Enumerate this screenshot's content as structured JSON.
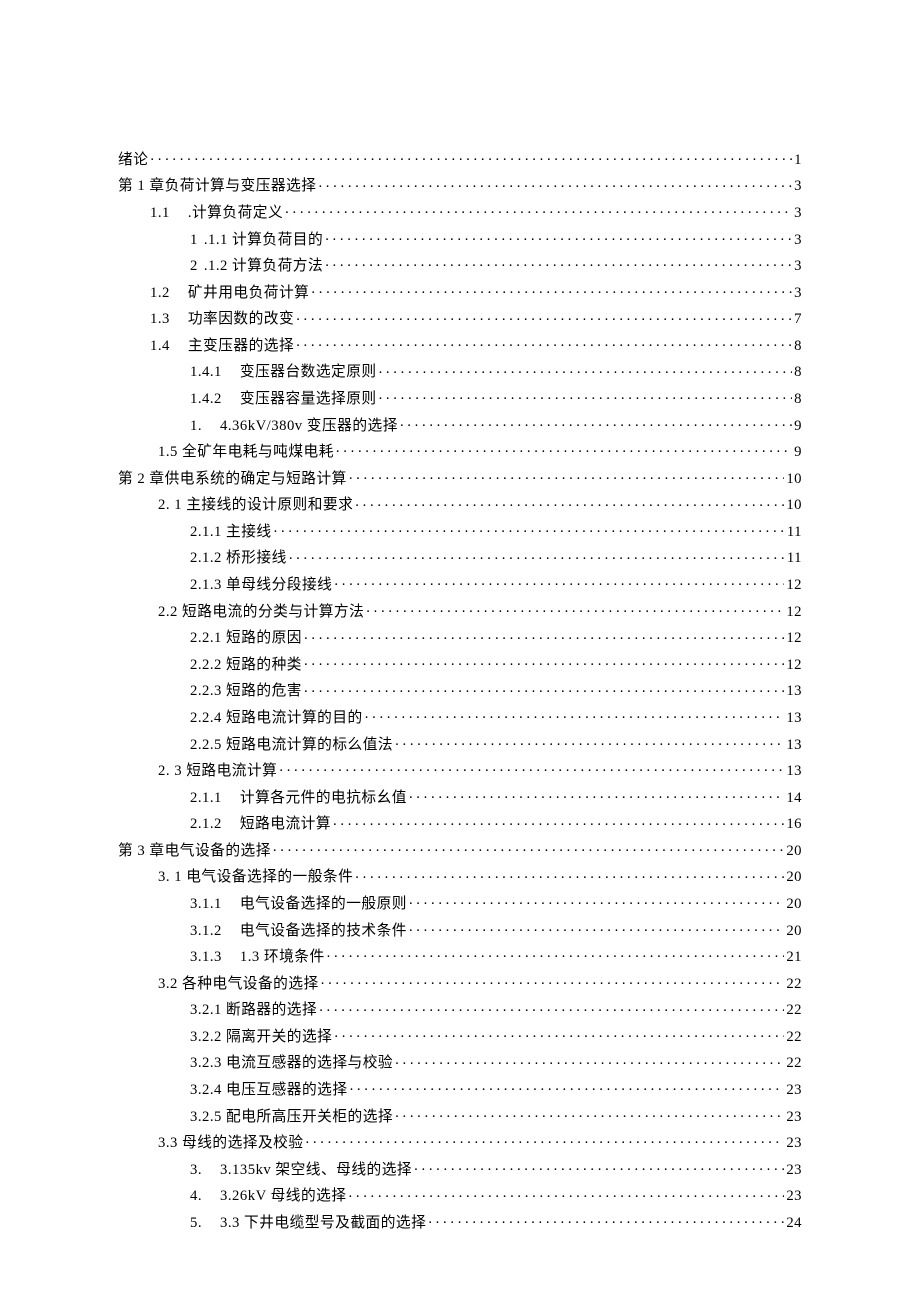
{
  "toc": [
    {
      "indent": "lv0",
      "num": "",
      "label": "绪论",
      "page": "1"
    },
    {
      "indent": "lv0",
      "num": "",
      "label": "第 1 章负荷计算与变压器选择",
      "page": "3"
    },
    {
      "indent": "lv1",
      "num": "1.1",
      "label": ".计算负荷定义",
      "page": "3"
    },
    {
      "indent": "lv2",
      "num": "1",
      "label": ".1.1 计算负荷目的",
      "page": "3"
    },
    {
      "indent": "lv2",
      "num": "2",
      "label": ".1.2 计算负荷方法",
      "page": "3"
    },
    {
      "indent": "lv1",
      "num": "1.2",
      "label": "矿井用电负荷计算",
      "page": "3"
    },
    {
      "indent": "lv1",
      "num": "1.3",
      "label": "功率因数的改变",
      "page": "7"
    },
    {
      "indent": "lv1",
      "num": "1.4",
      "label": "主变压器的选择",
      "page": "8"
    },
    {
      "indent": "lv2",
      "num": "1.4.1",
      "label": "变压器台数选定原则",
      "page": "8"
    },
    {
      "indent": "lv2",
      "num": "1.4.2",
      "label": "变压器容量选择原则",
      "page": "8"
    },
    {
      "indent": "lv2",
      "num": "1.",
      "label": "4.36kV/380v 变压器的选择",
      "page": "9"
    },
    {
      "indent": "lv1b",
      "num": "",
      "label": "1.5 全矿年电耗与吨煤电耗",
      "page": "9"
    },
    {
      "indent": "lv0",
      "num": "",
      "label": "第 2 章供电系统的确定与短路计算",
      "page": "10"
    },
    {
      "indent": "lv1b",
      "num": "",
      "label": "2.  1 主接线的设计原则和要求",
      "page": "10"
    },
    {
      "indent": "lv2b",
      "num": "",
      "label": "2.1.1 主接线",
      "page": "11"
    },
    {
      "indent": "lv2b",
      "num": "",
      "label": "2.1.2 桥形接线",
      "page": "11"
    },
    {
      "indent": "lv2b",
      "num": "",
      "label": "2.1.3 单母线分段接线",
      "page": "12"
    },
    {
      "indent": "lv1b",
      "num": "",
      "label": "2.2 短路电流的分类与计算方法",
      "page": "12"
    },
    {
      "indent": "lv2b",
      "num": "",
      "label": "2.2.1 短路的原因",
      "page": "12"
    },
    {
      "indent": "lv2b",
      "num": "",
      "label": "2.2.2 短路的种类",
      "page": "12"
    },
    {
      "indent": "lv2b",
      "num": "",
      "label": "2.2.3 短路的危害",
      "page": "13"
    },
    {
      "indent": "lv2b",
      "num": "",
      "label": "2.2.4 短路电流计算的目的",
      "page": "13"
    },
    {
      "indent": "lv2b",
      "num": "",
      "label": "2.2.5 短路电流计算的标么值法",
      "page": "13"
    },
    {
      "indent": "lv1b",
      "num": "",
      "label": "2.  3 短路电流计算",
      "page": "13"
    },
    {
      "indent": "lv2",
      "num": "2.1.1",
      "label": "计算各元件的电抗标幺值",
      "page": "14"
    },
    {
      "indent": "lv2",
      "num": "2.1.2",
      "label": "短路电流计算",
      "page": "16"
    },
    {
      "indent": "lv0",
      "num": "",
      "label": "第 3 章电气设备的选择",
      "page": "20"
    },
    {
      "indent": "lv1b",
      "num": "",
      "label": "3.  1 电气设备选择的一般条件",
      "page": "20"
    },
    {
      "indent": "lv2",
      "num": "3.1.1",
      "label": "电气设备选择的一般原则",
      "page": "20"
    },
    {
      "indent": "lv2",
      "num": "3.1.2",
      "label": "电气设备选择的技术条件",
      "page": "20"
    },
    {
      "indent": "lv2",
      "num": "3.1.3",
      "label": "1.3 环境条件",
      "page": "21"
    },
    {
      "indent": "lv1b",
      "num": "",
      "label": "3.2 各种电气设备的选择",
      "page": "22"
    },
    {
      "indent": "lv2b",
      "num": "",
      "label": "3.2.1 断路器的选择",
      "page": "22"
    },
    {
      "indent": "lv2b",
      "num": "",
      "label": "3.2.2 隔离开关的选择",
      "page": "22"
    },
    {
      "indent": "lv2b",
      "num": "",
      "label": "3.2.3 电流互感器的选择与校验",
      "page": "22"
    },
    {
      "indent": "lv2b",
      "num": "",
      "label": "3.2.4 电压互感器的选择",
      "page": "23"
    },
    {
      "indent": "lv2b",
      "num": "",
      "label": "3.2.5 配电所高压开关柜的选择",
      "page": "23"
    },
    {
      "indent": "lv1b",
      "num": "",
      "label": "3.3 母线的选择及校验",
      "page": "23"
    },
    {
      "indent": "lv2",
      "num": "3.",
      "label": "3.135kv 架空线、母线的选择",
      "page": "23"
    },
    {
      "indent": "lv2",
      "num": "4.",
      "label": "3.26kV 母线的选择",
      "page": "23"
    },
    {
      "indent": "lv2",
      "num": "5.",
      "label": "3.3 下井电缆型号及截面的选择",
      "page": "24"
    }
  ]
}
